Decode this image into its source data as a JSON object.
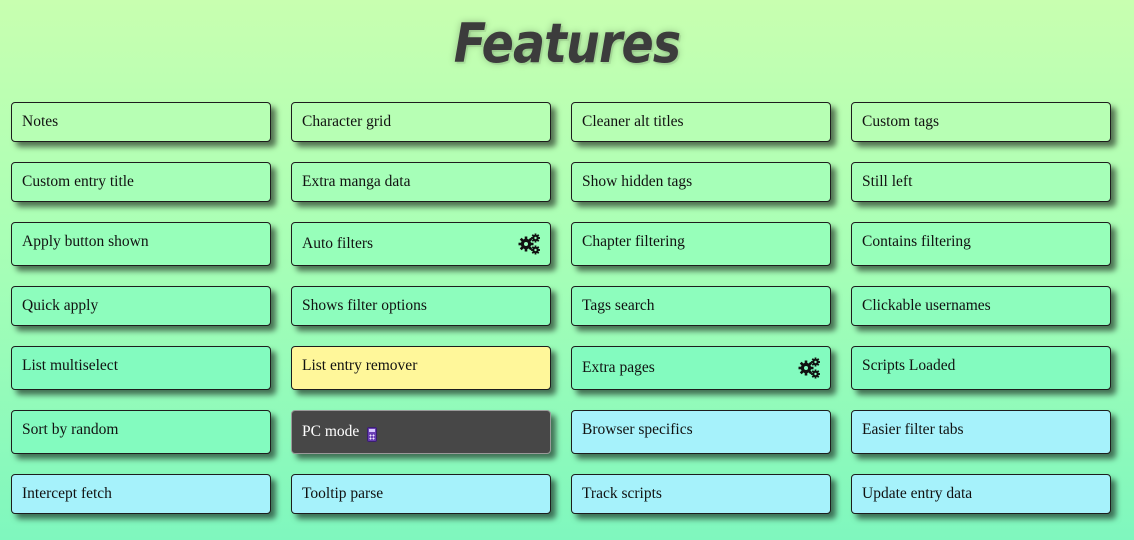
{
  "page": {
    "title": "Features"
  },
  "features": [
    {
      "label": "Notes"
    },
    {
      "label": "Character grid"
    },
    {
      "label": "Cleaner alt titles"
    },
    {
      "label": "Custom tags"
    },
    {
      "label": "Custom entry title"
    },
    {
      "label": "Extra manga data"
    },
    {
      "label": "Show hidden tags"
    },
    {
      "label": "Still left"
    },
    {
      "label": "Apply button shown"
    },
    {
      "label": "Auto filters",
      "icon": "gears-icon"
    },
    {
      "label": "Chapter filtering"
    },
    {
      "label": "Contains filtering"
    },
    {
      "label": "Quick apply"
    },
    {
      "label": "Shows filter options"
    },
    {
      "label": "Tags search"
    },
    {
      "label": "Clickable usernames"
    },
    {
      "label": "List multiselect"
    },
    {
      "label": "List entry remover",
      "state": "highlighted"
    },
    {
      "label": "Extra pages",
      "icon": "gears-icon"
    },
    {
      "label": "Scripts Loaded"
    },
    {
      "label": "Sort by random"
    },
    {
      "label": "PC mode",
      "icon": "calculator-icon",
      "state": "active"
    },
    {
      "label": "Browser specifics"
    },
    {
      "label": "Easier filter tabs"
    },
    {
      "label": "Intercept fetch"
    },
    {
      "label": "Tooltip parse"
    },
    {
      "label": "Track scripts"
    },
    {
      "label": "Update entry data"
    }
  ],
  "colors": {
    "background_top": "#c8ffb0",
    "background_bottom": "#7ff7be",
    "title_text": "#3c3c3c",
    "highlight_yellow": "#fff79a",
    "active_dark": "#474747",
    "cyan_card": "#a6f2fb"
  }
}
